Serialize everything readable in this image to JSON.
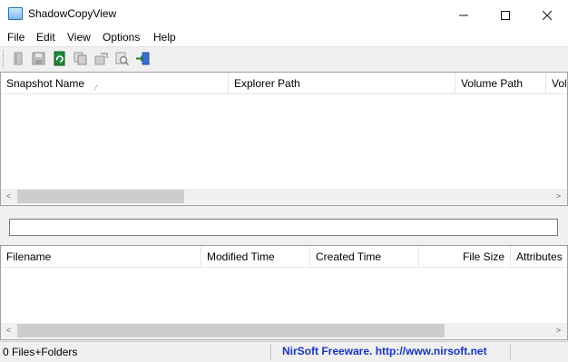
{
  "window": {
    "title": "ShadowCopyView",
    "controls": {
      "minimize": "—",
      "maximize": "☐",
      "close": "✕"
    }
  },
  "menu": [
    "File",
    "Edit",
    "View",
    "Options",
    "Help"
  ],
  "toolbar": {
    "buttons": [
      "properties-icon",
      "save-icon",
      "refresh-icon",
      "copy-icon",
      "copy-files-icon",
      "find-icon",
      "exit-icon"
    ]
  },
  "snapshots": {
    "columns": [
      "Snapshot Name",
      "Explorer Path",
      "Volume Path",
      "Vol"
    ],
    "rows": []
  },
  "path": {
    "value": ""
  },
  "files": {
    "columns": [
      "Filename",
      "Modified Time",
      "Created Time",
      "File Size",
      "Attributes"
    ],
    "rows": []
  },
  "scroll_glyphs": {
    "left": "<",
    "right": ">"
  },
  "status": {
    "count": "0 Files+Folders",
    "link": "NirSoft Freeware.  http://www.nirsoft.net"
  },
  "colors": {
    "link": "#1a33cc",
    "border": "#a0a0a0",
    "thumb": "#cdcdcd"
  }
}
